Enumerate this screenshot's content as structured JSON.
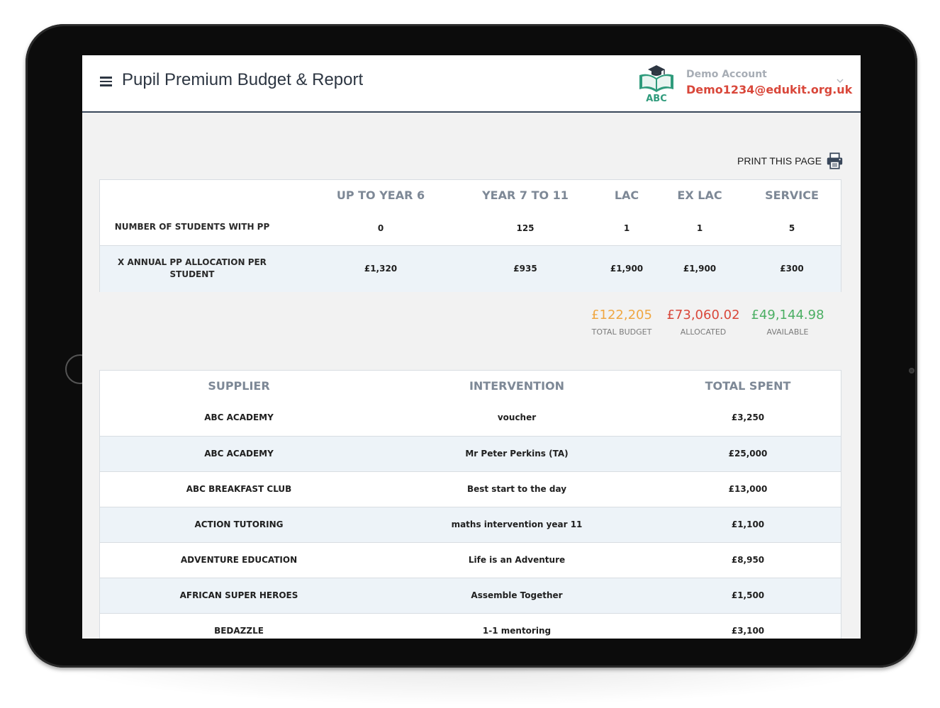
{
  "header": {
    "title": "Pupil Premium Budget & Report",
    "logo_text": "ABC",
    "account_name": "Demo Account",
    "account_email": "Demo1234@edukit.org.uk"
  },
  "print_label": "PRINT THIS PAGE",
  "pp_table": {
    "columns": [
      "UP TO YEAR 6",
      "YEAR 7 TO 11",
      "LAC",
      "EX LAC",
      "SERVICE"
    ],
    "rows": [
      {
        "label": "NUMBER OF STUDENTS WITH PP",
        "values": [
          "0",
          "125",
          "1",
          "1",
          "5"
        ]
      },
      {
        "label_line1": "X ANNUAL PP ALLOCATION PER",
        "label_line2": "STUDENT",
        "values": [
          "£1,320",
          "£935",
          "£1,900",
          "£1,900",
          "£300"
        ]
      }
    ]
  },
  "summary": {
    "total_budget": {
      "value": "£122,205",
      "label": "TOTAL BUDGET",
      "color": "#f0a742"
    },
    "allocated": {
      "value": "£73,060.02",
      "label": "ALLOCATED",
      "color": "#d9473a"
    },
    "available": {
      "value": "£49,144.98",
      "label": "AVAILABLE",
      "color": "#4caf64"
    }
  },
  "supplier_table": {
    "columns": [
      "SUPPLIER",
      "INTERVENTION",
      "TOTAL SPENT"
    ],
    "rows": [
      [
        "ABC ACADEMY",
        "voucher",
        "£3,250"
      ],
      [
        "ABC ACADEMY",
        "Mr Peter Perkins (TA)",
        "£25,000"
      ],
      [
        "ABC BREAKFAST CLUB",
        "Best start to the day",
        "£13,000"
      ],
      [
        "ACTION TUTORING",
        "maths intervention year 11",
        "£1,100"
      ],
      [
        "ADVENTURE EDUCATION",
        "Life is an Adventure",
        "£8,950"
      ],
      [
        "AFRICAN SUPER HEROES",
        "Assemble Together",
        "£1,500"
      ],
      [
        "BEDAZZLE",
        "1-1 mentoring",
        "£3,100"
      ]
    ]
  },
  "colors": {
    "accent_red": "#d9473a",
    "header_border": "#39475a",
    "row_alt": "#edf3f8"
  }
}
